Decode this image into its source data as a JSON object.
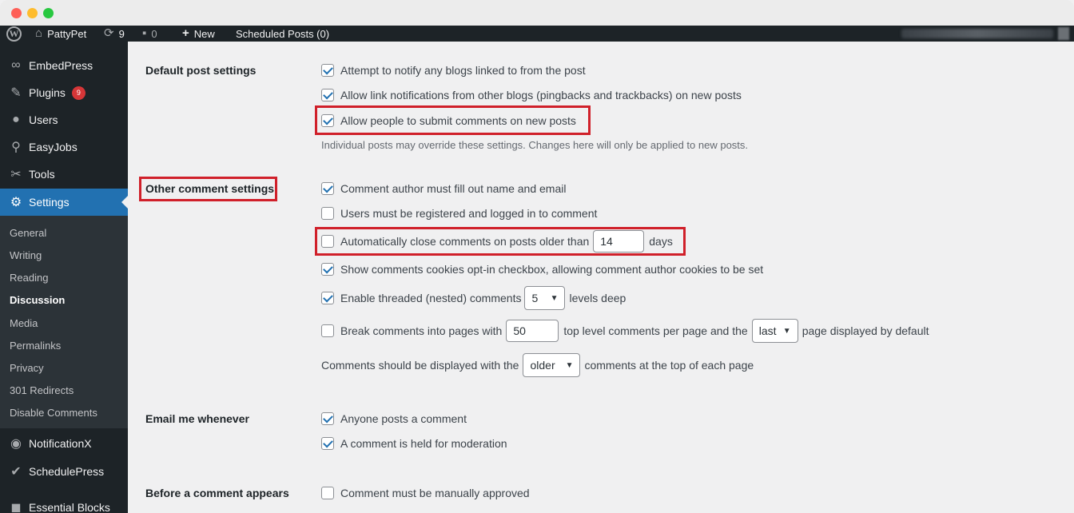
{
  "adminbar": {
    "site_name": "PattyPet",
    "updates_count": "9",
    "comments_count": "0",
    "new_label": "New",
    "scheduled_label": "Scheduled Posts (0)"
  },
  "sidebar": {
    "items": [
      {
        "label": "EmbedPress",
        "icon": "embedpress-icon"
      },
      {
        "label": "Plugins",
        "icon": "plugins-icon",
        "badge": "9"
      },
      {
        "label": "Users",
        "icon": "users-icon"
      },
      {
        "label": "EasyJobs",
        "icon": "easyjobs-icon"
      },
      {
        "label": "Tools",
        "icon": "tools-icon"
      },
      {
        "label": "Settings",
        "icon": "settings-icon"
      },
      {
        "label": "NotificationX",
        "icon": "notificationx-icon"
      },
      {
        "label": "SchedulePress",
        "icon": "schedulepress-icon"
      },
      {
        "label": "Essential Blocks",
        "icon": "essential-blocks-icon"
      }
    ],
    "submenu": [
      "General",
      "Writing",
      "Reading",
      "Discussion",
      "Media",
      "Permalinks",
      "Privacy",
      "301 Redirects",
      "Disable Comments"
    ]
  },
  "settings": {
    "default_post": {
      "label": "Default post settings",
      "options": [
        {
          "label": "Attempt to notify any blogs linked to from the post",
          "checked": true
        },
        {
          "label": "Allow link notifications from other blogs (pingbacks and trackbacks) on new posts",
          "checked": true
        },
        {
          "label": "Allow people to submit comments on new posts",
          "checked": true
        }
      ],
      "description": "Individual posts may override these settings. Changes here will only be applied to new posts."
    },
    "other_comment": {
      "label": "Other comment settings",
      "author_required": "Comment author must fill out name and email",
      "registered_required": "Users must be registered and logged in to comment",
      "auto_close_prefix": "Automatically close comments on posts older than",
      "auto_close_days": "14",
      "auto_close_suffix": "days",
      "cookies_optin": "Show comments cookies opt-in checkbox, allowing comment author cookies to be set",
      "threaded_prefix": "Enable threaded (nested) comments",
      "threaded_levels": "5",
      "threaded_suffix": "levels deep",
      "paged_prefix": "Break comments into pages with",
      "paged_count": "50",
      "paged_middle": "top level comments per page and the",
      "paged_default": "last",
      "paged_suffix": "page displayed by default",
      "order_prefix": "Comments should be displayed with the",
      "order_value": "older",
      "order_suffix": "comments at the top of each page"
    },
    "email_me": {
      "label": "Email me whenever",
      "anyone_posts": "Anyone posts a comment",
      "held_moderation": "A comment is held for moderation"
    },
    "before_appears": {
      "label": "Before a comment appears",
      "manually_approved": "Comment must be manually approved"
    }
  },
  "colors": {
    "accent": "#2271b1",
    "highlight": "#d0202a",
    "sidebar_bg": "#1d2327"
  }
}
